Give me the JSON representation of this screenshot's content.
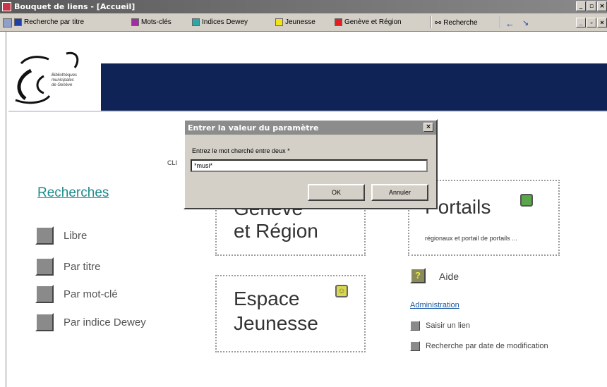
{
  "window": {
    "title": "Bouquet de liens - [Accueil]",
    "controls": [
      "_",
      "▫",
      "×"
    ]
  },
  "toolbar": {
    "items": [
      {
        "label": "Recherche par titre",
        "color": "#1f3fa8"
      },
      {
        "label": "Mots-clés",
        "color": "#a12fa1"
      },
      {
        "label": "Indices Dewey",
        "color": "#2aa7a7"
      },
      {
        "label": "Jeunesse",
        "color": "#f2e21a"
      },
      {
        "label": "Genève et Région",
        "color": "#e02020"
      }
    ],
    "search_label": "Recherche",
    "right_controls": [
      "_",
      "▫",
      "×"
    ]
  },
  "logo": {
    "lines": [
      "Bibliothèques",
      "municipales",
      "de Genève"
    ]
  },
  "left": {
    "section_title": "Recherches",
    "links": [
      "Libre",
      "Par titre",
      "Par mot-clé",
      "Par indice Dewey"
    ]
  },
  "boxes": {
    "geneve": {
      "title_line1": "Genève",
      "title_line2": "et Région"
    },
    "jeunesse": {
      "title_line1": "Espace",
      "title_line2": "Jeunesse"
    },
    "portails": {
      "title": "Portails",
      "description": "régionaux et portail de portails ..."
    }
  },
  "clip_text": "CLI",
  "aide": {
    "label": "Aide"
  },
  "admin": {
    "title": "Administration",
    "links": [
      "Saisir un lien",
      "Recherche par date de modification"
    ]
  },
  "dialog": {
    "title": "Entrer la valeur du paramètre",
    "prompt": "Entrez le mot cherché entre deux *",
    "input_value": "*musi*",
    "ok_label": "OK",
    "cancel_label": "Annuler"
  }
}
